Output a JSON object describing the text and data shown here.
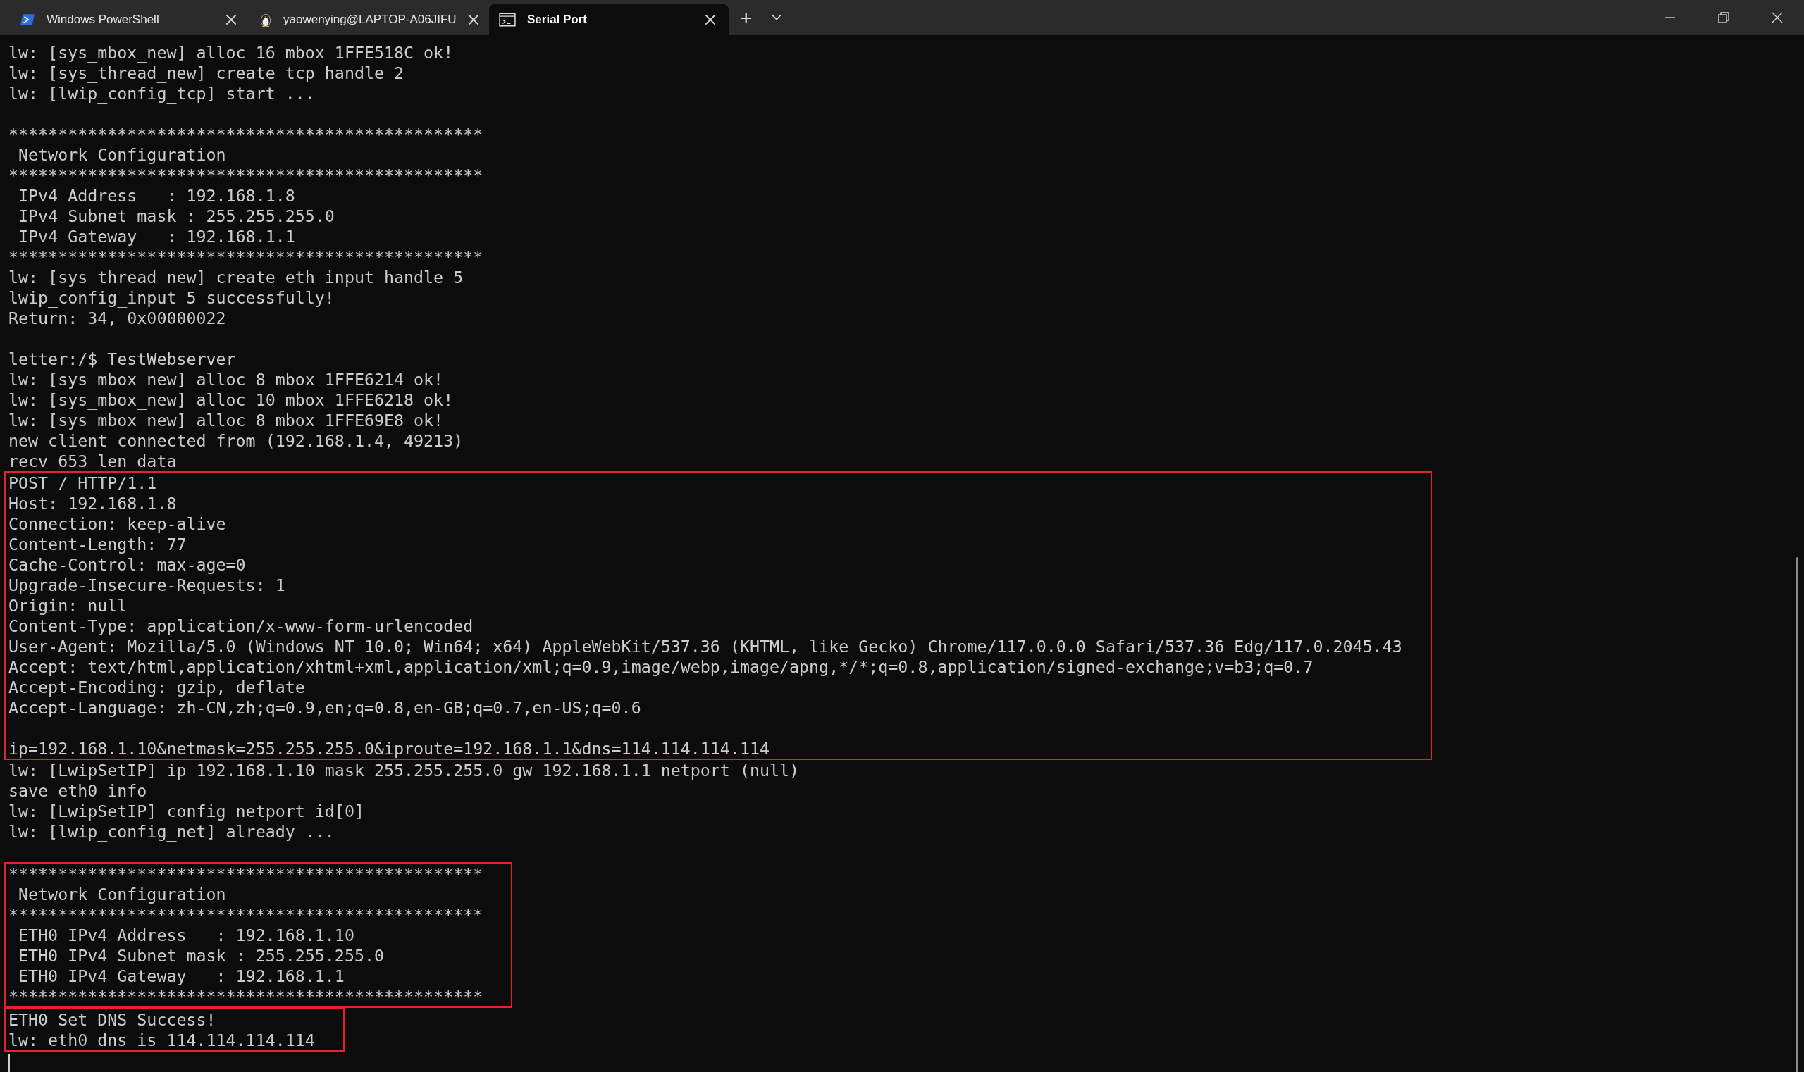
{
  "tabs": [
    {
      "label": "Windows PowerShell",
      "kind": "powershell",
      "selected": false
    },
    {
      "label": "yaowenying@LAPTOP-A06JIFU",
      "kind": "penguin",
      "selected": false
    },
    {
      "label": "Serial Port",
      "kind": "console",
      "selected": true
    }
  ],
  "new_tab": "+",
  "terminal": {
    "groups": [
      {
        "boxed": false,
        "lines": [
          {
            "kind": "text",
            "text": "lw: [sys_mbox_new] alloc 16 mbox 1FFE518C ok!"
          },
          {
            "kind": "text",
            "text": "lw: [sys_thread_new] create tcp handle 2"
          },
          {
            "kind": "text",
            "text": "lw: [lwip_config_tcp] start ..."
          },
          {
            "kind": "blank"
          },
          {
            "kind": "text",
            "text": "************************************************"
          },
          {
            "kind": "text",
            "text": " Network Configuration"
          },
          {
            "kind": "text",
            "text": "************************************************"
          },
          {
            "kind": "text",
            "text": " IPv4 Address   : 192.168.1.8"
          },
          {
            "kind": "text",
            "text": " IPv4 Subnet mask : 255.255.255.0"
          },
          {
            "kind": "text",
            "text": " IPv4 Gateway   : 192.168.1.1"
          },
          {
            "kind": "text",
            "text": "************************************************"
          },
          {
            "kind": "text",
            "text": "lw: [sys_thread_new] create eth_input handle 5"
          },
          {
            "kind": "text",
            "text": "lwip_config_input 5 successfully!"
          },
          {
            "kind": "text",
            "text": "Return: 34, 0x00000022"
          },
          {
            "kind": "blank"
          },
          {
            "kind": "text",
            "text": "letter:/$ TestWebserver"
          },
          {
            "kind": "text",
            "text": "lw: [sys_mbox_new] alloc 8 mbox 1FFE6214 ok!"
          },
          {
            "kind": "text",
            "text": "lw: [sys_mbox_new] alloc 10 mbox 1FFE6218 ok!"
          },
          {
            "kind": "text",
            "text": "lw: [sys_mbox_new] alloc 8 mbox 1FFE69E8 ok!"
          },
          {
            "kind": "text",
            "text": "new client connected from (192.168.1.4, 49213)"
          },
          {
            "kind": "text",
            "text": "recv 653 len data"
          }
        ]
      },
      {
        "boxed": true,
        "lines": [
          {
            "kind": "text",
            "text": "POST / HTTP/1.1"
          },
          {
            "kind": "text",
            "text": "Host: 192.168.1.8"
          },
          {
            "kind": "text",
            "text": "Connection: keep-alive"
          },
          {
            "kind": "text",
            "text": "Content-Length: 77"
          },
          {
            "kind": "text",
            "text": "Cache-Control: max-age=0"
          },
          {
            "kind": "text",
            "text": "Upgrade-Insecure-Requests: 1"
          },
          {
            "kind": "text",
            "text": "Origin: null"
          },
          {
            "kind": "text",
            "text": "Content-Type: application/x-www-form-urlencoded"
          },
          {
            "kind": "text",
            "text": "User-Agent: Mozilla/5.0 (Windows NT 10.0; Win64; x64) AppleWebKit/537.36 (KHTML, like Gecko) Chrome/117.0.0.0 Safari/537.36 Edg/117.0.2045.43"
          },
          {
            "kind": "text",
            "text": "Accept: text/html,application/xhtml+xml,application/xml;q=0.9,image/webp,image/apng,*/*;q=0.8,application/signed-exchange;v=b3;q=0.7"
          },
          {
            "kind": "text",
            "text": "Accept-Encoding: gzip, deflate"
          },
          {
            "kind": "text",
            "text": "Accept-Language: zh-CN,zh;q=0.9,en;q=0.8,en-GB;q=0.7,en-US;q=0.6"
          },
          {
            "kind": "blank"
          },
          {
            "kind": "text",
            "text": "ip=192.168.1.10&netmask=255.255.255.0&iproute=192.168.1.1&dns=114.114.114.114"
          }
        ]
      },
      {
        "boxed": false,
        "lines": [
          {
            "kind": "text",
            "text": "lw: [LwipSetIP] ip 192.168.1.10 mask 255.255.255.0 gw 192.168.1.1 netport (null)"
          },
          {
            "kind": "text",
            "text": "save eth0 info"
          },
          {
            "kind": "text",
            "text": "lw: [LwipSetIP] config netport id[0]"
          },
          {
            "kind": "text",
            "text": "lw: [lwip_config_net] already ..."
          },
          {
            "kind": "blank"
          }
        ]
      },
      {
        "boxed": true,
        "lines": [
          {
            "kind": "text",
            "text": "************************************************"
          },
          {
            "kind": "text",
            "text": " Network Configuration"
          },
          {
            "kind": "text",
            "text": "************************************************"
          },
          {
            "kind": "text",
            "text": " ETH0 IPv4 Address   : 192.168.1.10"
          },
          {
            "kind": "text",
            "text": " ETH0 IPv4 Subnet mask : 255.255.255.0"
          },
          {
            "kind": "text",
            "text": " ETH0 IPv4 Gateway   : 192.168.1.1"
          },
          {
            "kind": "text",
            "text": "************************************************"
          }
        ]
      },
      {
        "boxed": true,
        "lines": [
          {
            "kind": "text",
            "text": "ETH0 Set DNS Success!"
          },
          {
            "kind": "text",
            "text": "lw: eth0 dns is 114.114.114.114"
          }
        ]
      }
    ]
  }
}
